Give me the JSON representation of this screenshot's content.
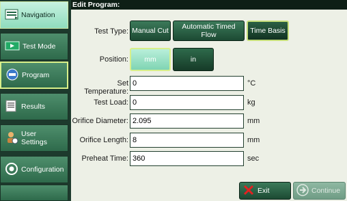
{
  "sidebar": {
    "items": [
      {
        "label": "Navigation",
        "icon": "navigation-icon"
      },
      {
        "label": "Test Mode",
        "icon": "test-mode-icon"
      },
      {
        "label": "Program",
        "icon": "program-icon"
      },
      {
        "label": "Results",
        "icon": "results-icon"
      },
      {
        "label": "User\nSettings",
        "icon": "user-settings-icon"
      },
      {
        "label": "Configuration",
        "icon": "configuration-icon"
      }
    ]
  },
  "header": {
    "title": "Edit Program:"
  },
  "test_type": {
    "label": "Test Type:",
    "options": [
      "Manual Cut",
      "Automatic Timed Flow",
      "Time Basis"
    ],
    "selected": "Time Basis"
  },
  "position": {
    "label": "Position:",
    "options": [
      "mm",
      "in"
    ],
    "selected": "mm"
  },
  "fields": [
    {
      "label": "Set Temperature:",
      "value": "0",
      "unit": "°C"
    },
    {
      "label": "Test Load:",
      "value": "0",
      "unit": "kg"
    },
    {
      "label": "Orifice Diameter:",
      "value": "2.095",
      "unit": "mm"
    },
    {
      "label": "Orifice Length:",
      "value": "8",
      "unit": "mm"
    },
    {
      "label": "Preheat Time:",
      "value": "360",
      "unit": "sec"
    }
  ],
  "footer": {
    "exit_label": "Exit",
    "continue_label": "Continue"
  },
  "colors": {
    "accent": "#cfe9a6",
    "panel": "#1d3a2d",
    "button": "#2e6a4b"
  }
}
